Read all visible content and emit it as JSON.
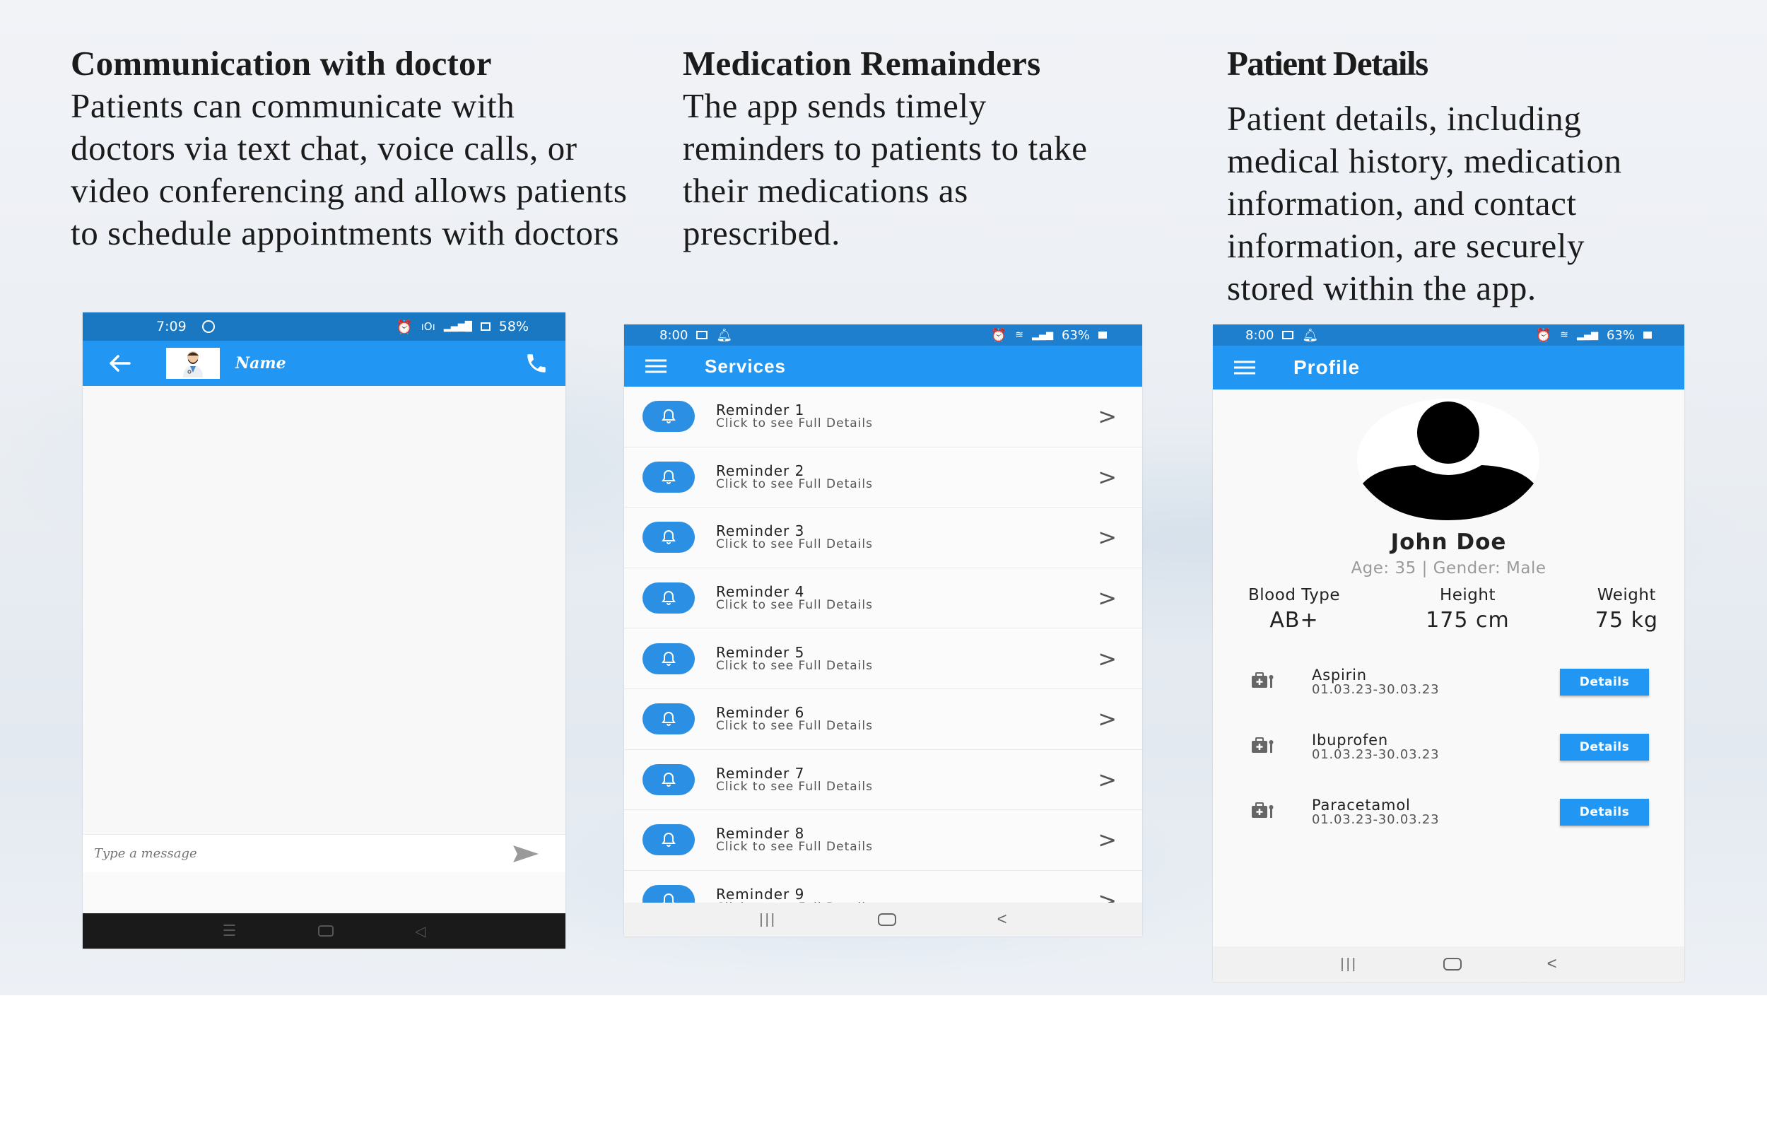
{
  "sections": {
    "communication": {
      "title": "Communication with doctor",
      "body": " Patients can communicate with\ndoctors via text chat, voice calls, or\nvideo conferencing and allows patients\nto schedule  appointments with doctors"
    },
    "medication": {
      "title": "Medication Remainders",
      "body": " The app sends timely\nreminders to patients to take\ntheir medications as\nprescribed."
    },
    "patient": {
      "title": "Patient Details",
      "body": "Patient details, including\nmedical history, medication\ninformation, and contact\ninformation, are securely\nstored within the app."
    }
  },
  "chat_screen": {
    "status_time": "7:09",
    "status_battery": "58%",
    "contact_name": "Name",
    "input_placeholder": "Type a message"
  },
  "services_screen": {
    "status_time": "8:00",
    "status_battery": "63%",
    "title": "Services",
    "items": [
      {
        "title": "Reminder 1",
        "subtitle": "Click to see Full Details"
      },
      {
        "title": "Reminder 2",
        "subtitle": "Click to see Full Details"
      },
      {
        "title": "Reminder 3",
        "subtitle": "Click to see Full Details"
      },
      {
        "title": "Reminder 4",
        "subtitle": "Click to see Full Details"
      },
      {
        "title": "Reminder 5",
        "subtitle": "Click to see Full Details"
      },
      {
        "title": "Reminder 6",
        "subtitle": "Click to see Full Details"
      },
      {
        "title": "Reminder 7",
        "subtitle": "Click to see Full Details"
      },
      {
        "title": "Reminder 8",
        "subtitle": "Click to see Full Details"
      },
      {
        "title": "Reminder 9",
        "subtitle": "Click to see Full Details"
      }
    ],
    "chevron": ">"
  },
  "profile_screen": {
    "status_time": "8:00",
    "status_battery": "63%",
    "title": "Profile",
    "name": "John Doe",
    "meta": "Age: 35 | Gender: Male",
    "stats": [
      {
        "label": "Blood Type",
        "value": "AB+"
      },
      {
        "label": "Height",
        "value": "175 cm"
      },
      {
        "label": "Weight",
        "value": "75 kg"
      }
    ],
    "medications": [
      {
        "name": "Aspirin",
        "dates": "01.03.23-30.03.23",
        "button": "Details"
      },
      {
        "name": "Ibuprofen",
        "dates": "01.03.23-30.03.23",
        "button": "Details"
      },
      {
        "name": "Paracetamol",
        "dates": "01.03.23-30.03.23",
        "button": "Details"
      }
    ]
  },
  "colors": {
    "app_bar": "#2196f3",
    "status_bar": "#1a78c2",
    "reminder_badge": "#2b8fe4"
  }
}
